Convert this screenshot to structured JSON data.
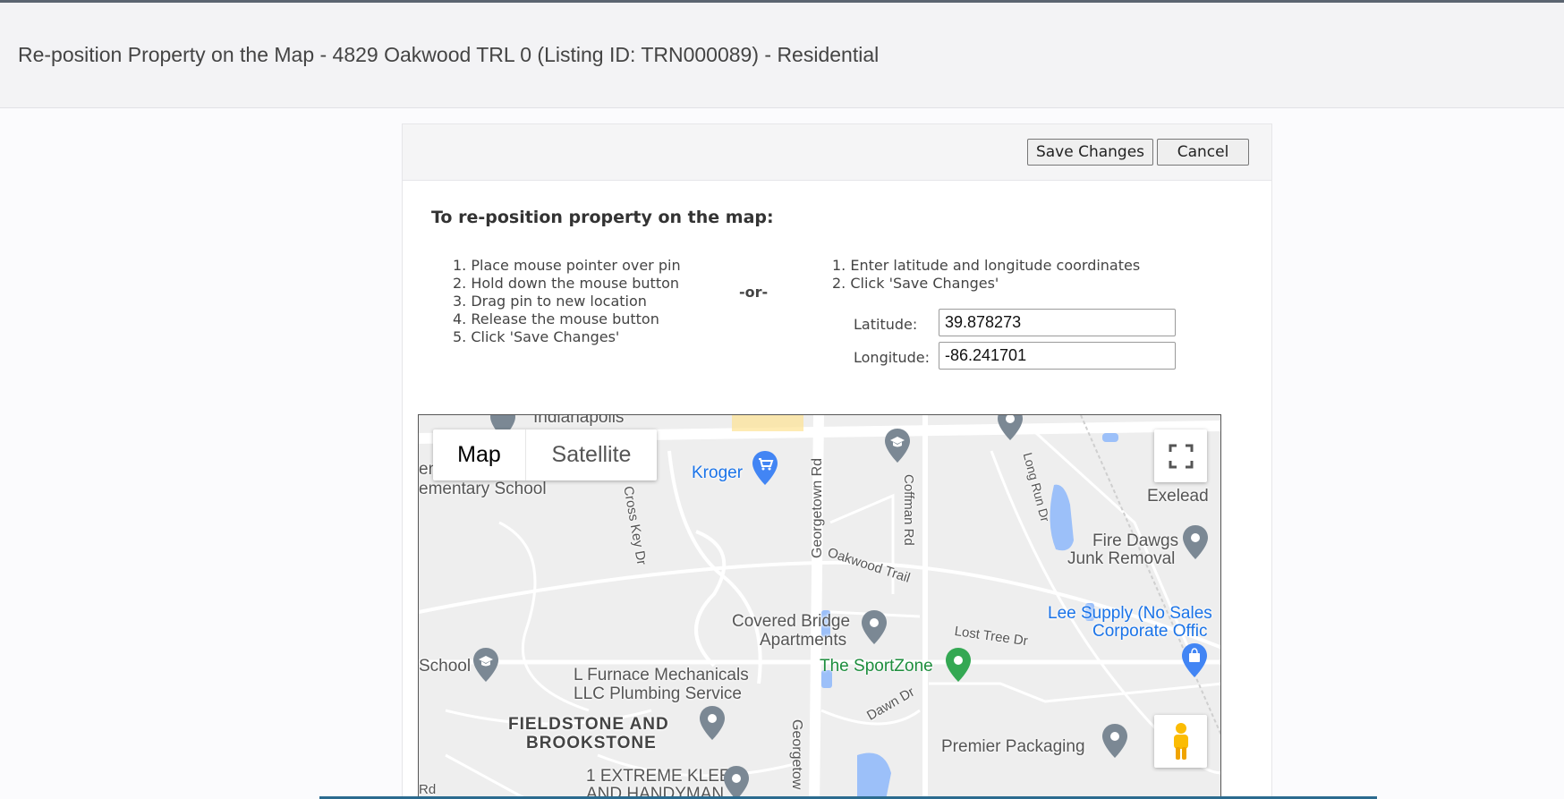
{
  "header": {
    "title": "Re-position Property on the Map - 4829 Oakwood TRL 0 (Listing ID: TRN000089) - Residential"
  },
  "toolbar": {
    "save_label": "Save Changes",
    "cancel_label": "Cancel"
  },
  "instructions": {
    "title": "To re-position property on the map:",
    "drag_steps": [
      "1. Place mouse pointer over pin",
      "2. Hold down the mouse button",
      "3. Drag pin to new location",
      "4. Release the mouse button",
      "5. Click 'Save Changes'"
    ],
    "or_label": "-or-",
    "coord_steps": [
      "1. Enter latitude and longitude coordinates",
      "2. Click 'Save Changes'"
    ]
  },
  "coordinates": {
    "latitude_label": "Latitude:",
    "latitude_value": "39.878273",
    "longitude_label": "Longitude:",
    "longitude_value": "-86.241701"
  },
  "map": {
    "type_map_label": "Map",
    "type_satellite_label": "Satellite",
    "labels": {
      "indianapolis": "Indianapolis",
      "elementary": "ementary School",
      "school_left_prefix": "en",
      "school": "School",
      "kroger": "Kroger",
      "cross_key": "Cross Key Dr",
      "georgetown": "Georgetown Rd",
      "georgetown2": "Georgetow",
      "coffman": "Coffman Rd",
      "long_run": "Long Run Dr",
      "exelead": "Exelead",
      "fire_dawgs_1": "Fire Dawgs",
      "fire_dawgs_2": "Junk Removal",
      "oakwood": "Oakwood Trail",
      "covered_1": "Covered Bridge",
      "covered_2": "Apartments",
      "lee_1": "Lee Supply (No Sales",
      "lee_2": "Corporate Offic",
      "lost_tree": "Lost Tree Dr",
      "sportzone": "The SportZone",
      "furnace_1": "L Furnace Mechanicals",
      "furnace_2": "LLC Plumbing Service",
      "fieldstone_1": "FIELDSTONE AND",
      "fieldstone_2": "BROOKSTONE",
      "dawn": "Dawn Dr",
      "premier": "Premier Packaging",
      "extreme_1": "1 EXTREME KLEEN",
      "extreme_2": "AND HANDYMAN",
      "rd": "Rd"
    }
  },
  "colors": {
    "accent_blue": "#1a73e8",
    "poi_gray": "#7b8894",
    "sport_green": "#34a853"
  }
}
